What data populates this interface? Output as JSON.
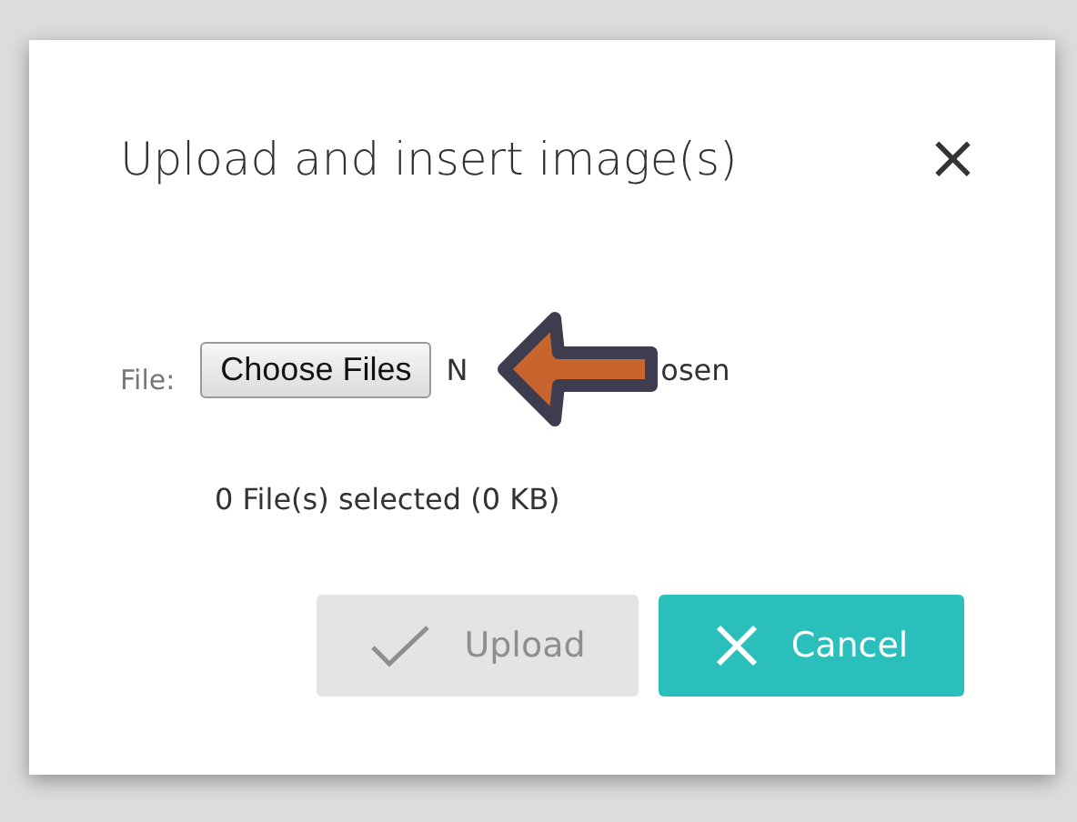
{
  "dialog": {
    "title": "Upload and insert image(s)",
    "close": "×"
  },
  "file_field": {
    "label": "File:",
    "button": "Choose Files",
    "status_parts": [
      "N",
      "osen"
    ]
  },
  "summary": "0 File(s) selected (0 KB)",
  "buttons": [
    {
      "kind": "upload",
      "label": "Upload",
      "disabled": true
    },
    {
      "kind": "cancel",
      "label": "Cancel",
      "disabled": false
    }
  ]
}
